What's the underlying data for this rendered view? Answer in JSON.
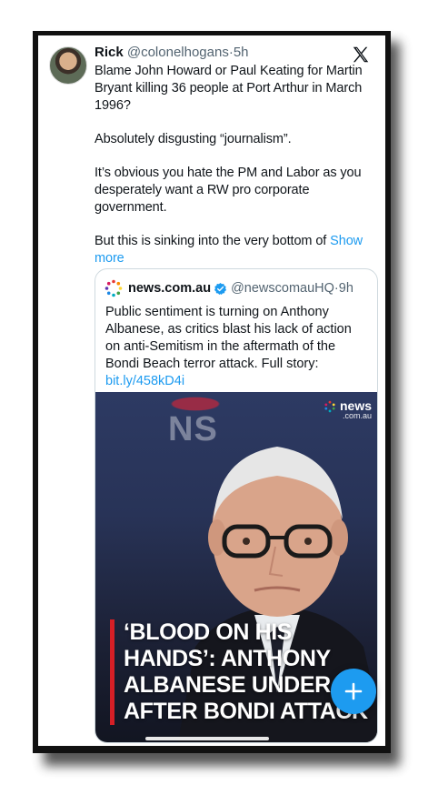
{
  "tweet": {
    "author_name": "Rick",
    "author_handle": "@colonelhogans",
    "separator": "·",
    "time": "5h",
    "paragraphs": [
      "Blame John Howard or Paul Keating for Martin Bryant killing 36 people at Port Arthur in March 1996?",
      "Absolutely disgusting “journalism”.",
      "It’s obvious you hate the PM and Labor as you desperately want a RW pro corporate government."
    ],
    "last_paragraph": "But this is sinking into the very bottom of ",
    "show_more_label": "Show more"
  },
  "quoted": {
    "author_name": "news.com.au",
    "author_handle": "@newscomauHQ",
    "separator": "·",
    "time": "9h",
    "text": "Public sentiment is turning on Anthony Albanese, as critics blast his lack of action on anti-Semitism in the aftermath of the Bondi Beach terror attack. Full story: ",
    "link_text": "bit.ly/458kD4i",
    "media": {
      "background_text": "NS",
      "watermark_main": "news",
      "watermark_sub": ".com.au",
      "headline_lines": [
        "‘BLOOD ON HIS",
        "HANDS’: ANTHONY",
        "ALBANESE UNDER F",
        "AFTER BONDI ATTACK"
      ]
    }
  },
  "icons": {
    "app_logo": "x-logo-icon",
    "verified": "verified-badge-icon",
    "compose": "plus-icon"
  },
  "colors": {
    "accent": "#1d9bf0",
    "headline_bar": "#d61f26",
    "text": "#0f1419",
    "muted": "#536471"
  }
}
